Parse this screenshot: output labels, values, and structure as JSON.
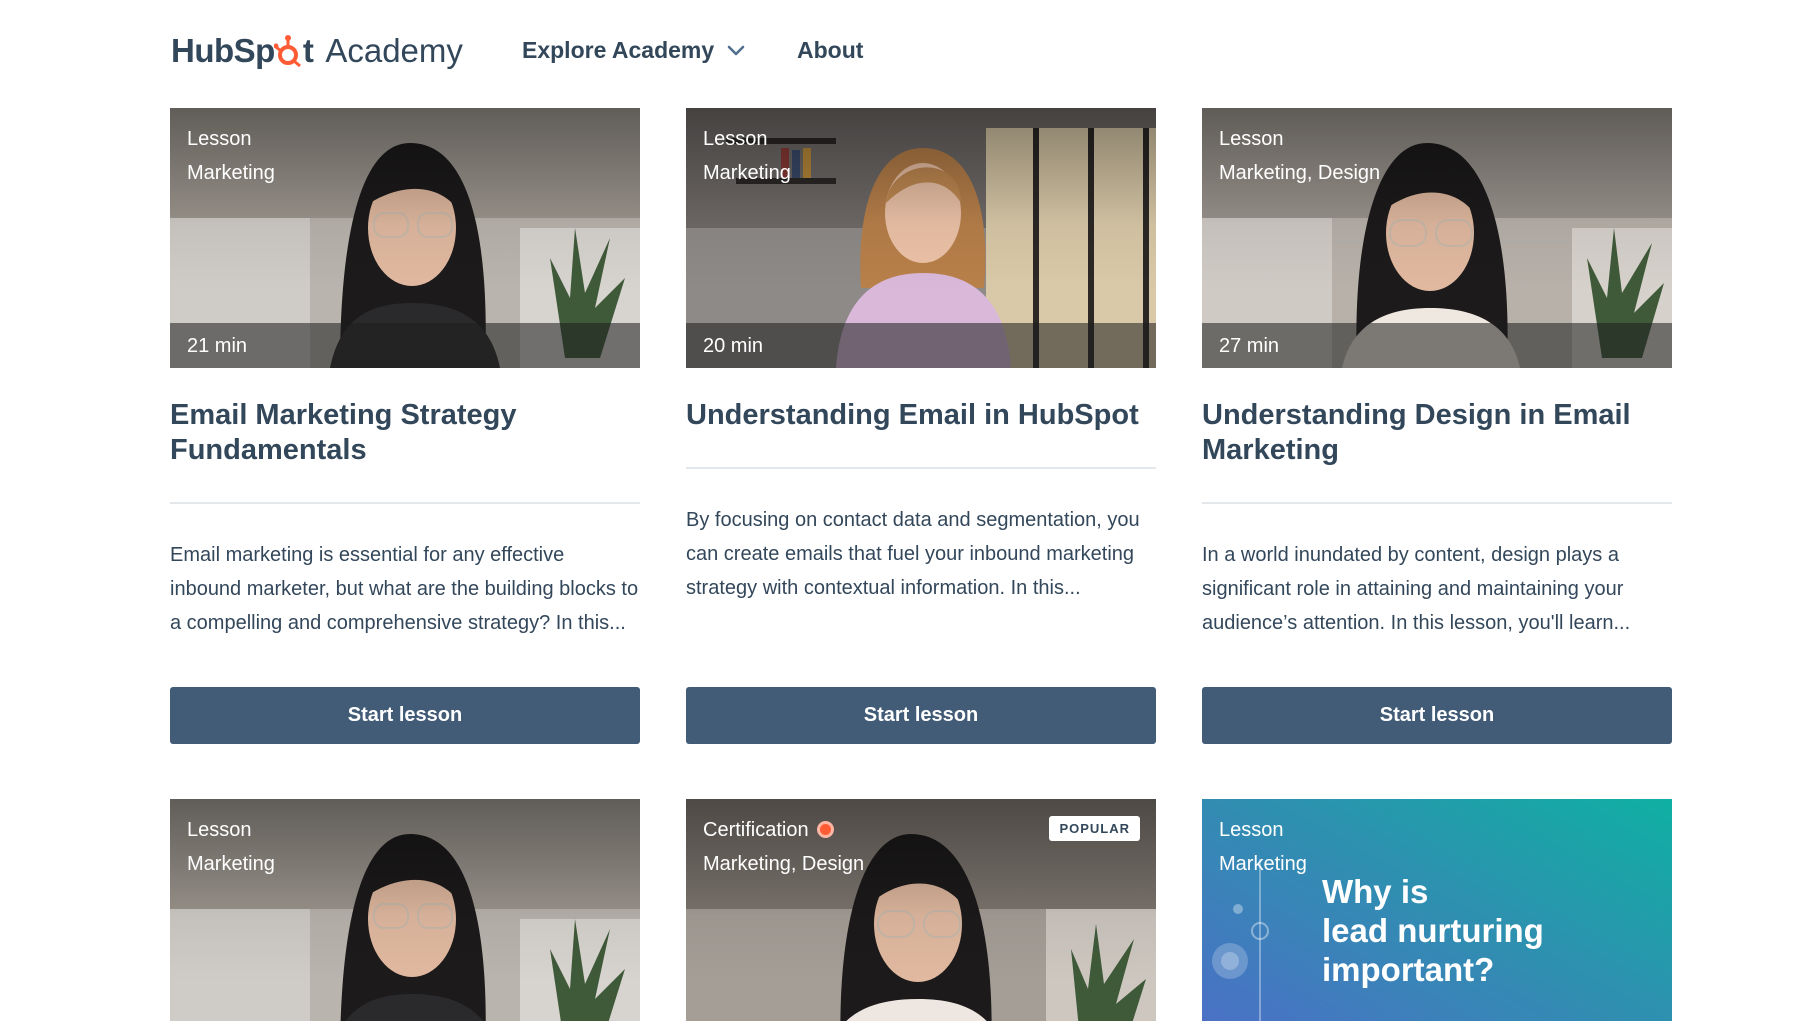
{
  "header": {
    "logo_brand_left": "HubSp",
    "logo_brand_right": "t",
    "logo_product": "Academy",
    "nav": [
      {
        "label": "Explore Academy",
        "has_dropdown": true
      },
      {
        "label": "About",
        "has_dropdown": false
      }
    ]
  },
  "colors": {
    "primary_text": "#33475b",
    "button_bg": "#425b76",
    "accent_orange": "#ff5c35",
    "divider": "#e5e8eb"
  },
  "cards": [
    {
      "type": "Lesson",
      "tags": "Marketing",
      "duration": "21 min",
      "title": "Email Marketing Strategy Fundamentals",
      "description": "Email marketing is essential for any effective inbound marketer, but what are the building blocks to a compelling and comprehensive strategy? In this...",
      "button": "Start lesson"
    },
    {
      "type": "Lesson",
      "tags": "Marketing",
      "duration": "20 min",
      "title": "Understanding Email in HubSpot",
      "description": "By focusing on contact data and segmentation, you can create emails that fuel your inbound marketing strategy with contextual information. In this...",
      "button": "Start lesson"
    },
    {
      "type": "Lesson",
      "tags": "Marketing, Design",
      "duration": "27 min",
      "title": "Understanding Design in Email Marketing",
      "description": "In a world inundated by content, design plays a significant role in attaining and maintaining your audience’s attention. In this lesson, you'll learn...",
      "button": "Start lesson"
    },
    {
      "type": "Lesson",
      "tags": "Marketing"
    },
    {
      "type": "Certification",
      "tags": "Marketing, Design",
      "badge": "POPULAR"
    },
    {
      "type": "Lesson",
      "tags": "Marketing",
      "thumbnail_text": [
        "Why is",
        "lead nurturing",
        "important?"
      ]
    }
  ]
}
